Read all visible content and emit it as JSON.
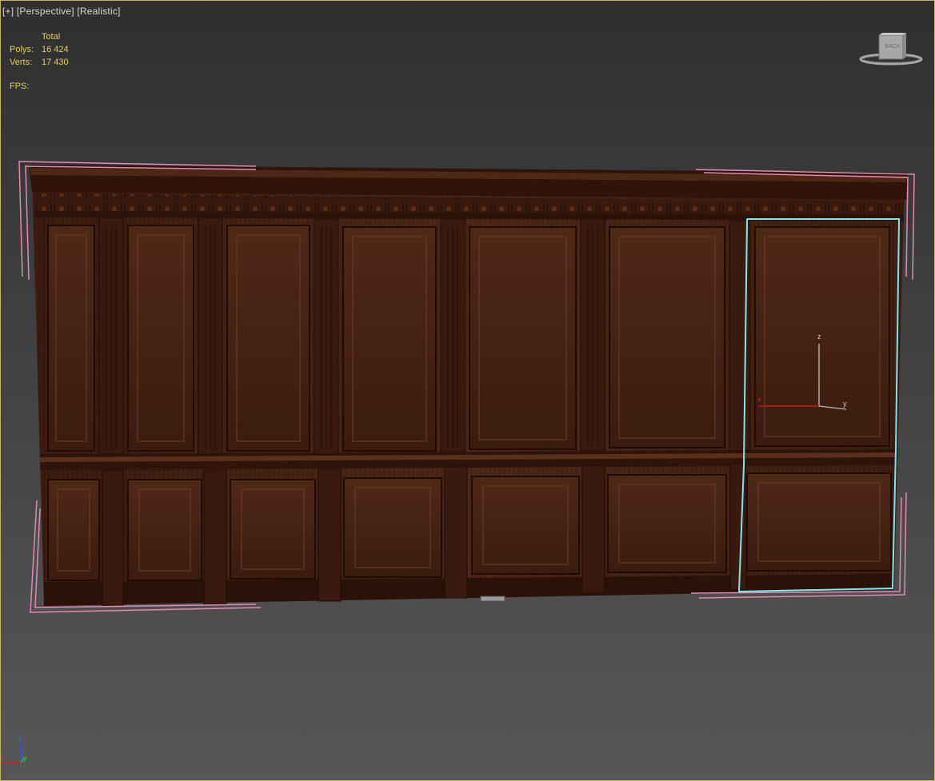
{
  "viewport": {
    "labels": [
      "[+]",
      "[Perspective]",
      "[Realistic]"
    ]
  },
  "stats": {
    "header": "Total",
    "polys_label": "Polys:",
    "polys_value": "16 424",
    "verts_label": "Verts:",
    "verts_value": "17 430",
    "fps_label": "FPS:"
  },
  "viewcube": {
    "face_label": "BACK"
  },
  "gizmo": {
    "x": "x",
    "y": "y",
    "z": "z"
  },
  "corner_axes": {
    "x": "x",
    "y": "y",
    "z": "z"
  },
  "colors": {
    "stats_text": "#e6cd5c",
    "selection": "#7fe6f0",
    "bbox": "#e08ab8",
    "wood_dark": "#2e140b",
    "wood_mid": "#4a2415",
    "wood_light": "#5c2f1c",
    "axis_x": "#d02020",
    "axis_y": "#20c020",
    "axis_z": "#3050ff"
  }
}
